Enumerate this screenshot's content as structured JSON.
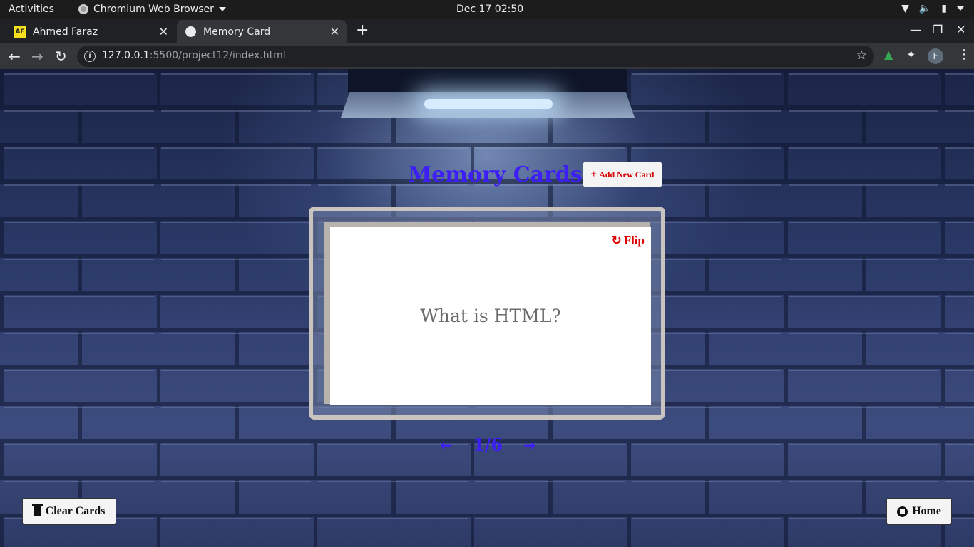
{
  "system_bar": {
    "activities": "Activities",
    "app_name": "Chromium Web Browser",
    "clock": "Dec 17  02:50"
  },
  "browser": {
    "tabs": [
      {
        "label": "Ahmed Faraz",
        "favicon": "AF"
      },
      {
        "label": "Memory Card",
        "favicon": "globe-icon"
      }
    ],
    "url_host": "127.0.0.1",
    "url_rest": ":5500/project12/index.html",
    "profile_initial": "F"
  },
  "page": {
    "title": "Memory Cards",
    "add_button": "Add New Card",
    "flip_button": "Flip",
    "card_question": "What is HTML?",
    "counter": "1/6",
    "clear_button": "Clear Cards",
    "home_button": "Home"
  },
  "colors": {
    "title": "#3d1ef5",
    "accent_red": "#e00000"
  }
}
